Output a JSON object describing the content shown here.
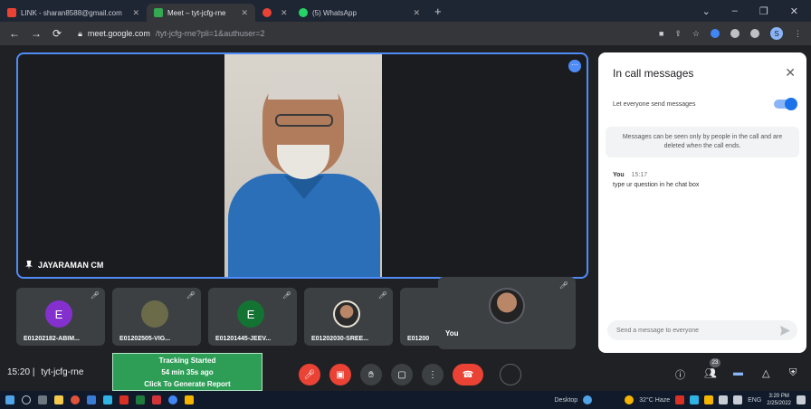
{
  "browser": {
    "tabs": [
      {
        "label": "LINK - sharan8588@gmail.com",
        "favicon_color": "#ea4335"
      },
      {
        "label": "Meet – tyt-jcfg-rne",
        "favicon_color": "#34a853",
        "active": true
      },
      {
        "label": "",
        "favicon_color": "#ea4335"
      },
      {
        "label": "(5) WhatsApp",
        "favicon_color": "#25d366"
      }
    ],
    "new_tab": "+",
    "url_host": "meet.google.com",
    "url_path": "/tyt-jcfg-rne?pli=1&authuser=2"
  },
  "stage": {
    "main_speaker": "JAYARAMAN CM",
    "participants": [
      {
        "initial": "E",
        "label": "E01202182-ABIM...",
        "color": "#8430ce"
      },
      {
        "initial": "",
        "label": "E01202505-VIG...",
        "color": "#6b6b4a"
      },
      {
        "initial": "E",
        "label": "E01201445-JEEV...",
        "color": "#137333"
      },
      {
        "initial": "",
        "label": "E01202030-SREE...",
        "color": "#d6c7b5"
      },
      {
        "initial": "",
        "label": "E01200",
        "color": "#3c4043"
      }
    ],
    "self_label": "You"
  },
  "chat": {
    "title": "In call messages",
    "toggle_label": "Let everyone send messages",
    "toggle_on": true,
    "notice": "Messages can be seen only by people in the call and are deleted when the call ends.",
    "message": {
      "sender": "You",
      "time": "15:17",
      "text": "type ur question in he chat box"
    },
    "input_placeholder": "Send a message to everyone"
  },
  "bottom": {
    "time": "15:20",
    "meeting_code": "tyt-jcfg-rne",
    "tracking": {
      "line1": "Tracking Started",
      "line2": "54 min 35s ago",
      "line3": "Click To Generate Report"
    },
    "people_count": "23"
  },
  "taskbar": {
    "desktop_label": "Desktop",
    "weather": "32°C  Haze",
    "lang": "ENG",
    "clock_time": "3:20 PM",
    "clock_date": "2/25/2022"
  }
}
